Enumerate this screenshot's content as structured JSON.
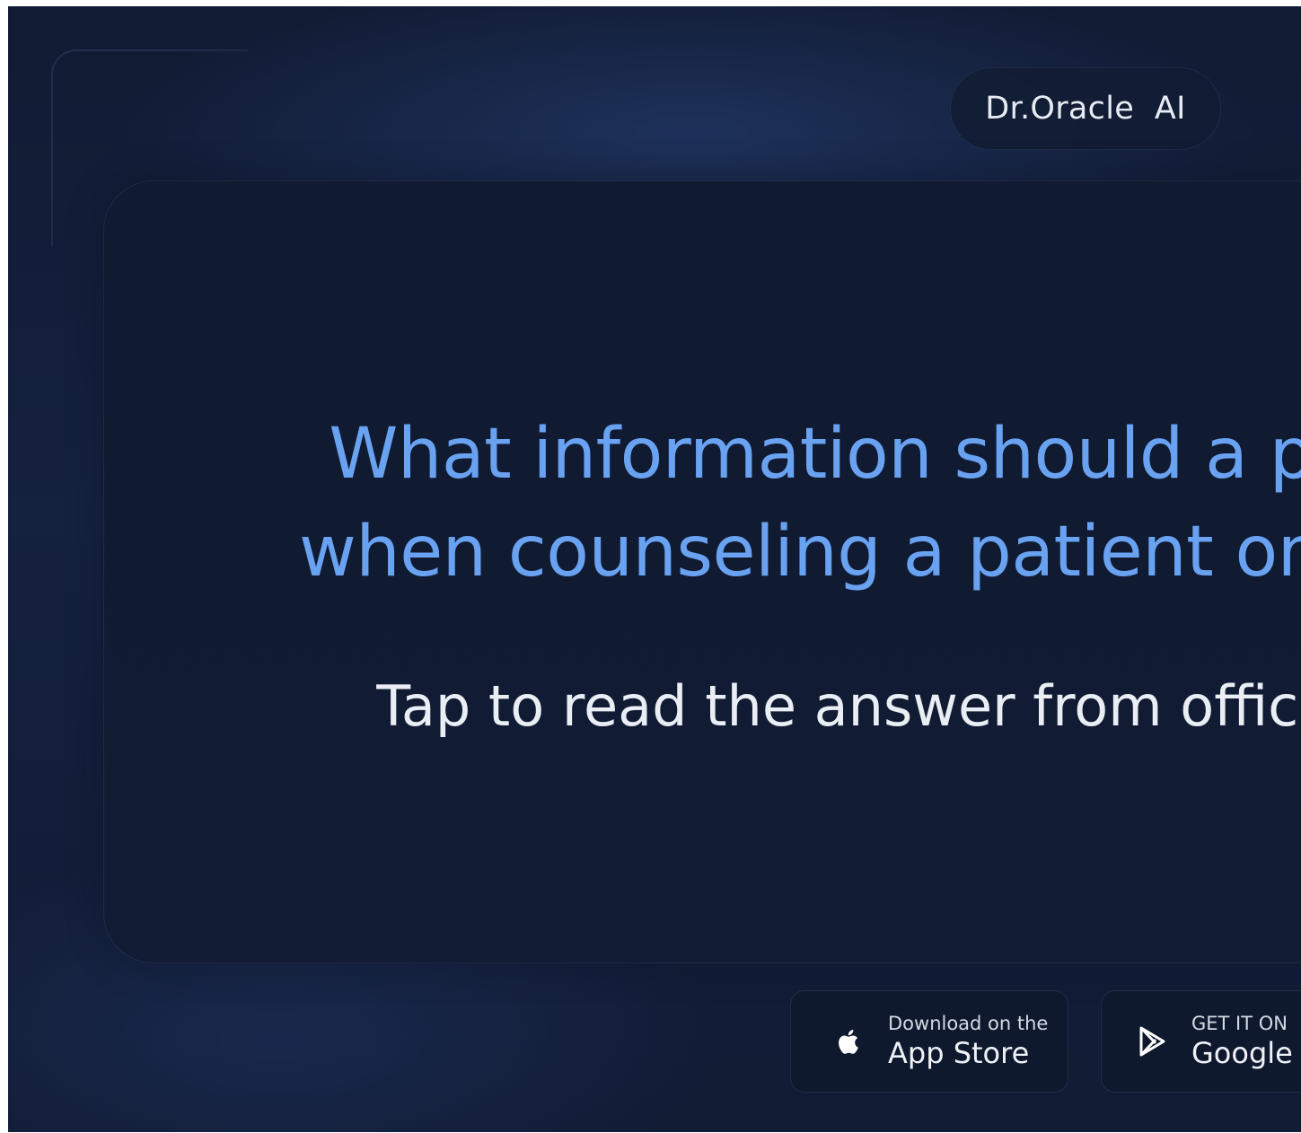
{
  "header": {
    "brand": "Dr.Oracle  AI"
  },
  "card": {
    "question_line1": "What information should a ph",
    "question_line2": "when counseling a patient on b",
    "subtitle": "Tap to read the answer from official"
  },
  "store_buttons": {
    "apple": {
      "small": "Download on the",
      "large": "App Store",
      "icon": "apple-icon"
    },
    "google": {
      "small": "GET IT ON",
      "large": "Google P",
      "icon": "google-play-icon"
    }
  },
  "colors": {
    "question_text": "#6aa2f2",
    "background": "#14213f",
    "card": "#101a31"
  }
}
